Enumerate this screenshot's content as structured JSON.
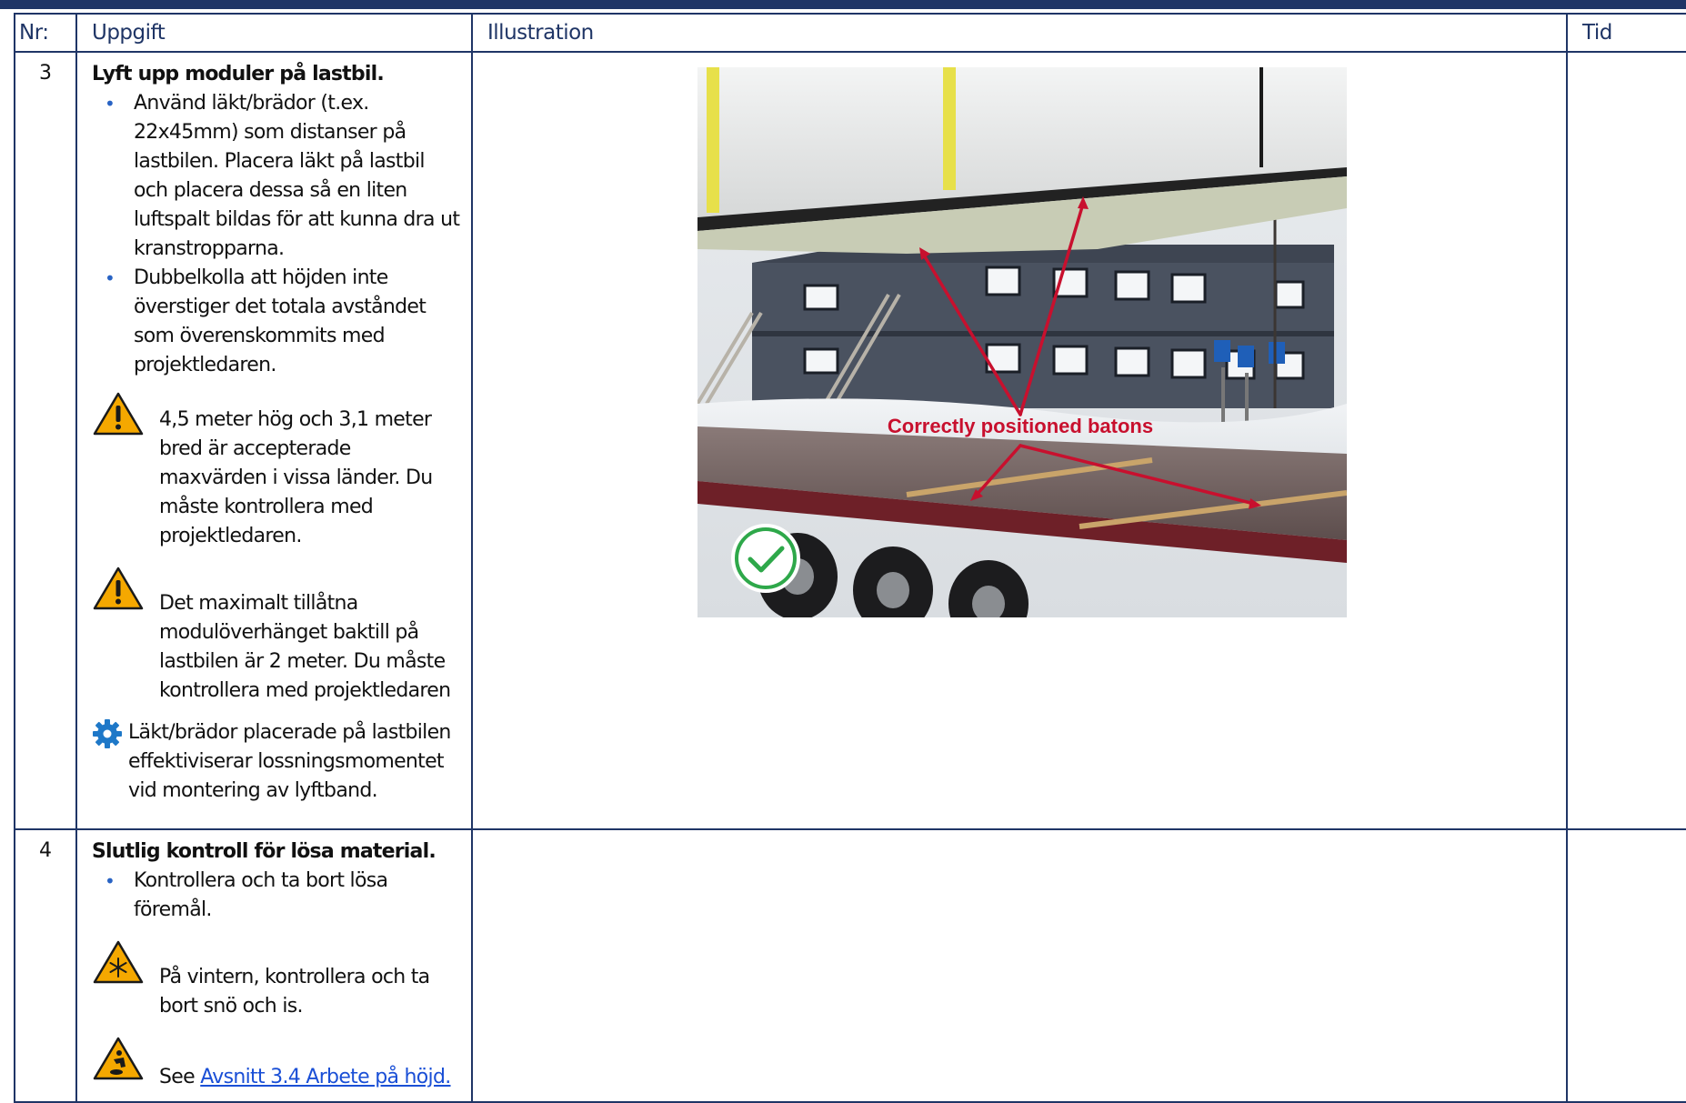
{
  "table": {
    "headers": {
      "nr": "Nr:",
      "task": "Uppgift",
      "illustration": "Illustration",
      "time": "Tid"
    }
  },
  "rows": [
    {
      "nr": "3",
      "title": "Lyft upp moduler på lastbil.",
      "bullets": [
        "Använd läkt/brädor (t.ex. 22x45mm) som distanser på lastbilen. Placera läkt på lastbil och placera dessa så en liten luftspalt bildas för att kunna dra ut kranstropparna.",
        "Dubbelkolla att höjden inte överstiger det totala avståndet som överenskommits med projektledaren."
      ],
      "warnings": [
        "4,5 meter hög och 3,1 meter bred är accepterade maxvärden i vissa länder. Du måste kontrollera med projektledaren.",
        "Det maximalt tillåtna modulöverhänget baktill på lastbilen är 2 meter. Du måste kontrollera med projektledaren"
      ],
      "tip": "Läkt/brädor placerade på lastbilen effektiviserar lossningsmomentet vid montering av lyftband.",
      "illustration": {
        "annotation": "Correctly positioned batons",
        "check_icon": "checkmark-icon"
      }
    },
    {
      "nr": "4",
      "title": "Slutlig kontroll för lösa material.",
      "bullets": [
        "Kontrollera och ta bort lösa föremål."
      ],
      "winter_note": "På vintern, kontrollera och ta bort snö och is.",
      "see_prefix": "See",
      "see_link": "Avsnitt 3.4 Arbete på höjd."
    }
  ],
  "colors": {
    "border": "#1f3566",
    "bullet": "#2863c4",
    "warning": "#f5a800",
    "annotation": "#c8102e",
    "check": "#2ea84a",
    "link": "#1a4fd6"
  }
}
